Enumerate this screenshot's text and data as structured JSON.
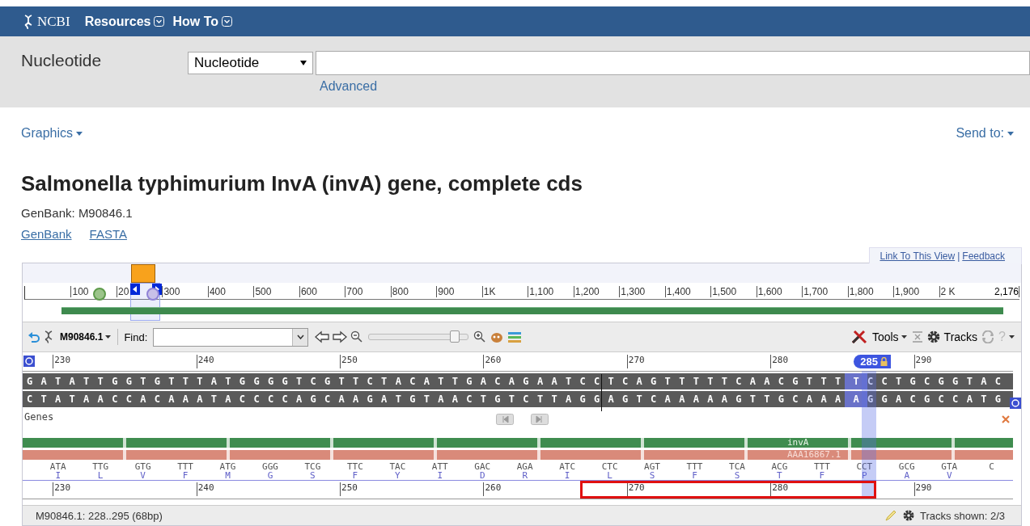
{
  "header": {
    "logo": "NCBI",
    "menus": [
      {
        "label": "Resources"
      },
      {
        "label": "How To"
      }
    ]
  },
  "search": {
    "database_label": "Nucleotide",
    "database_select": "Nucleotide",
    "advanced_link": "Advanced"
  },
  "page_links": {
    "left": "Graphics",
    "right": "Send to:"
  },
  "record": {
    "title": "Salmonella typhimurium InvA (invA) gene, complete cds",
    "accession": "GenBank: M90846.1",
    "links": [
      "GenBank",
      "FASTA"
    ]
  },
  "viewer": {
    "top_links": [
      "Link To This View",
      "Feedback"
    ],
    "separator": "|",
    "overview": {
      "ticks": [
        "100",
        "20",
        "300",
        "400",
        "500",
        "600",
        "700",
        "800",
        "900",
        "1K",
        "1,100",
        "1,200",
        "1,300",
        "1,400",
        "1,500",
        "1,600",
        "1,700",
        "1,800",
        "1,900",
        "2 K"
      ],
      "end_label": "2,176"
    },
    "toolbar": {
      "accession": "M90846.1",
      "find_label": "Find:",
      "zoom": {
        "level": 0.87
      },
      "tools": "Tools",
      "tracks": "Tracks",
      "help": "?"
    },
    "ruler": {
      "ticks": [
        "230",
        "240",
        "250",
        "260",
        "270",
        "280",
        "290"
      ]
    },
    "marker": {
      "label": "285"
    },
    "forward_strand": {
      "before": "GATATTGGTGTTTATGGGGTCGTTCTACATTGACAGAATCCTCAGTTTTTCAACGTTT",
      "selected": "T",
      "after": "CCTGCGGTAC"
    },
    "reverse_strand": {
      "before": "CTATAACCACAAATACCCCAGCAAGATGTAACTGTCTTAGGAGTCAAAAAGTTGCAAA",
      "selected": "A",
      "after": "GGACGCCATG"
    },
    "track_label": "Genes",
    "gene": {
      "label": "invA"
    },
    "protein": {
      "label": "AAA16867.1"
    },
    "codons": [
      {
        "codon": "ATA",
        "amino": "I"
      },
      {
        "codon": "TTG",
        "amino": "L"
      },
      {
        "codon": "GTG",
        "amino": "V"
      },
      {
        "codon": "TTT",
        "amino": "F"
      },
      {
        "codon": "ATG",
        "amino": "M"
      },
      {
        "codon": "GGG",
        "amino": "G"
      },
      {
        "codon": "TCG",
        "amino": "S"
      },
      {
        "codon": "TTC",
        "amino": "F"
      },
      {
        "codon": "TAC",
        "amino": "Y"
      },
      {
        "codon": "ATT",
        "amino": "I"
      },
      {
        "codon": "GAC",
        "amino": "D"
      },
      {
        "codon": "AGA",
        "amino": "R"
      },
      {
        "codon": "ATC",
        "amino": "I"
      },
      {
        "codon": "CTC",
        "amino": "L"
      },
      {
        "codon": "AGT",
        "amino": "S"
      },
      {
        "codon": "TTT",
        "amino": "F"
      },
      {
        "codon": "TCA",
        "amino": "S"
      },
      {
        "codon": "ACG",
        "amino": "T"
      },
      {
        "codon": "TTT",
        "amino": "F"
      },
      {
        "codon": "CCT",
        "amino": "P"
      },
      {
        "codon": "GCG",
        "amino": "A"
      },
      {
        "codon": "GTA",
        "amino": "V"
      },
      {
        "codon": "C"
      }
    ],
    "bottom_ruler": {
      "ticks": [
        "230",
        "240",
        "250",
        "260",
        "270",
        "280",
        "290"
      ]
    },
    "status": {
      "range": "M90846.1: 228..295 (68bp)",
      "tracks_shown": "Tracks shown: 2/3"
    }
  }
}
